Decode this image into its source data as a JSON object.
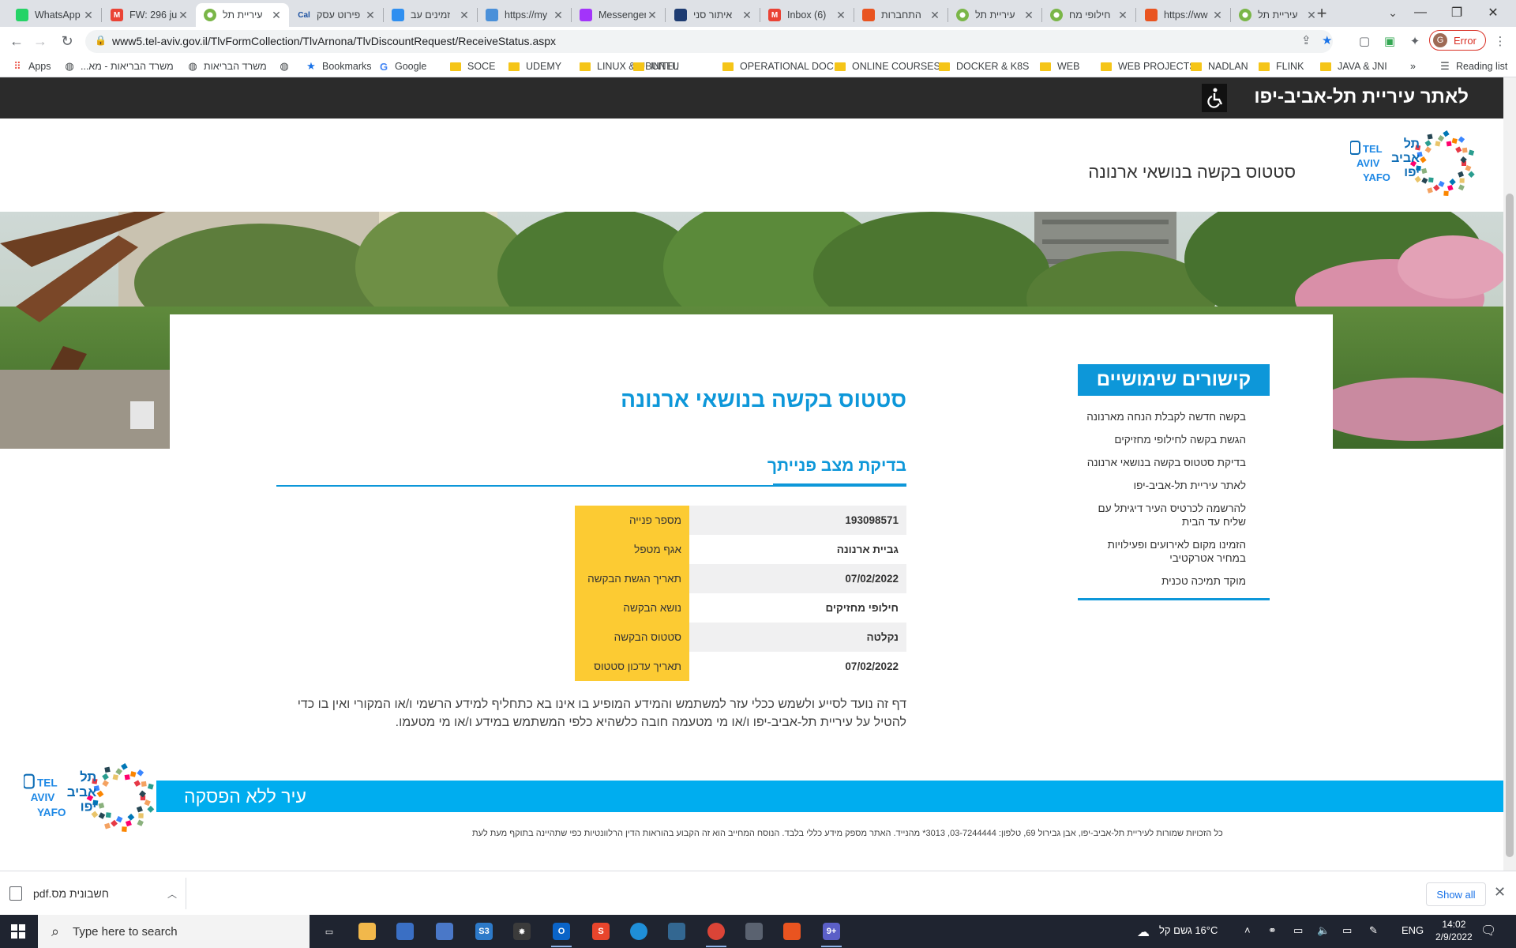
{
  "browser": {
    "tabs": [
      {
        "label": "WhatsApp",
        "icon": "whatsapp-icon",
        "color": "#25d366",
        "glyph": "",
        "active": false
      },
      {
        "label": "FW: 296 ju",
        "icon": "gmail-icon",
        "color": "#ea4335",
        "glyph": "M",
        "active": false
      },
      {
        "label": "עיריית תל",
        "icon": "tel-aviv-icon",
        "color": "#7ab648",
        "glyph": "",
        "active": true
      },
      {
        "label": "פירוט עסק",
        "icon": "cal-icon",
        "color": "#1a4fa0",
        "glyph": "Cal",
        "active": false
      },
      {
        "label": "זמינים עב",
        "icon": "edge-icon",
        "color": "#2f8ff0",
        "glyph": "",
        "active": false
      },
      {
        "label": "https://my",
        "icon": "web-icon",
        "color": "#4a90d9",
        "glyph": "",
        "active": false
      },
      {
        "label": "Messenger",
        "icon": "messenger-icon",
        "color": "#a334fa",
        "glyph": "",
        "active": false
      },
      {
        "label": "איתור סני",
        "icon": "drop-icon",
        "color": "#1e3c72",
        "glyph": "",
        "active": false
      },
      {
        "label": "Inbox (6)",
        "icon": "gmail-icon",
        "color": "#ea4335",
        "glyph": "M",
        "active": false
      },
      {
        "label": "התחברות",
        "icon": "ubuntu-icon",
        "color": "#e95420",
        "glyph": "",
        "active": false
      },
      {
        "label": "עיריית תל",
        "icon": "tel-aviv-icon",
        "color": "#7ab648",
        "glyph": "",
        "active": false
      },
      {
        "label": "חילופי מח",
        "icon": "tel-aviv-icon",
        "color": "#7ab648",
        "glyph": "",
        "active": false
      },
      {
        "label": "https://ww",
        "icon": "ubuntu-icon",
        "color": "#e95420",
        "glyph": "",
        "active": false
      },
      {
        "label": "עיריית תל",
        "icon": "tel-aviv-icon",
        "color": "#7ab648",
        "glyph": "",
        "active": false
      }
    ],
    "url": "www5.tel-aviv.gov.il/TlvFormCollection/TlvArnona/TlvDiscountRequest/ReceiveStatus.aspx",
    "profile_status": "Error",
    "profile_initial": "G",
    "bookmarks": [
      {
        "label": "Apps",
        "type": "apps"
      },
      {
        "label": "משרד הבריאות - מא...",
        "type": "site"
      },
      {
        "label": "משרד הבריאות",
        "type": "site"
      },
      {
        "label": "",
        "type": "site"
      },
      {
        "label": "Bookmarks",
        "type": "star"
      },
      {
        "label": "Google",
        "type": "google"
      },
      {
        "label": "SOCE",
        "type": "folder"
      },
      {
        "label": "UDEMY",
        "type": "folder"
      },
      {
        "label": "LINUX & UBUNTU",
        "type": "folder"
      },
      {
        "label": "INTEL",
        "type": "folder"
      },
      {
        "label": "OPERATIONAL DOC...",
        "type": "folder"
      },
      {
        "label": "ONLINE COURSES",
        "type": "folder"
      },
      {
        "label": "DOCKER & K8S",
        "type": "folder"
      },
      {
        "label": "WEB",
        "type": "folder"
      },
      {
        "label": "WEB PROJECTS",
        "type": "folder"
      },
      {
        "label": "NADLAN",
        "type": "folder"
      },
      {
        "label": "FLINK",
        "type": "folder"
      },
      {
        "label": "JAVA & JNI",
        "type": "folder"
      }
    ],
    "bookmarks_overflow": "»",
    "reading_list": "Reading list"
  },
  "page": {
    "topbar_link": "לאתר עיריית תל-אביב-יפו",
    "heading": "סטטוס בקשה בנושאי ארנונה",
    "logo": {
      "line1": "תל",
      "line2": "אביב",
      "line3": "יפו",
      "latin1": "TEL",
      "latin2": "AVIV",
      "latin3": "YAFO"
    },
    "sidebar": {
      "title": "קישורים שימושיים",
      "links": [
        "בקשה חדשה לקבלת הנחה מארנונה",
        "הגשת בקשה לחילופי מחזיקים",
        "בדיקת סטטוס בקשה בנושאי ארנונה",
        "לאתר עיריית תל-אביב-יפו",
        "להרשמה לכרטיס העיר דיגיתל עם שליח עד הבית",
        "הזמינו מקום לאירועים ופעילויות במחיר אטרקטיבי",
        "מוקד תמיכה טכנית"
      ]
    },
    "main_title": "סטטוס בקשה בנושאי ארנונה",
    "sub_title": "בדיקת מצב פנייתך",
    "status_rows": [
      {
        "label": "מספר פנייה",
        "value": "193098571"
      },
      {
        "label": "אגף מטפל",
        "value": "גביית ארנונה"
      },
      {
        "label": "תאריך הגשת הבקשה",
        "value": "07/02/2022"
      },
      {
        "label": "נושא הבקשה",
        "value": "חילופי מחזיקים"
      },
      {
        "label": "סטטוס הבקשה",
        "value": "נקלטה"
      },
      {
        "label": "תאריך עדכון סטטוס",
        "value": "07/02/2022"
      }
    ],
    "disclaimer": "דף זה נועד לסייע ולשמש ככלי עזר למשתמש והמידע המופיע בו אינו בא כתחליף למידע הרשמי ו/או המקורי ואין בו כדי להטיל על עיריית תל-אביב-יפו ו/או מי מטעמה חובה כלשהיא כלפי המשתמש במידע ו/או מי מטעמו.",
    "footer_slogan": "עיר ללא הפסקה",
    "footer_text": "כל הזכויות שמורות לעיריית תל-אביב-יפו, אבן גבירול 69, טלפון: 03-7244444, 3013* מהנייד. האתר מספק מידע כללי בלבד. הנוסח המחייב הוא זה הקבוע בהוראות הדין הרלוונטיות כפי שתהיינה בתוקף מעת לעת",
    "colors": {
      "primary": "#0d97d9",
      "table_label": "#fccb33",
      "footer_band": "#00adef",
      "topbar": "#2b2b2b"
    }
  },
  "downloads": {
    "file": "חשבונית מס.pdf",
    "show_all": "Show all"
  },
  "taskbar": {
    "search_placeholder": "Type here to search",
    "weather": "16°C  גשם קל",
    "language": "ENG",
    "time": "14:02",
    "date": "2/9/2022",
    "apps": [
      {
        "name": "task-view-icon",
        "color": "#1f2430",
        "glyph": "▭"
      },
      {
        "name": "file-explorer-icon",
        "color": "#f2b84b",
        "glyph": ""
      },
      {
        "name": "people-app-icon",
        "color": "#3a6fc4",
        "glyph": ""
      },
      {
        "name": "remote-app-icon",
        "color": "#4a78c8",
        "glyph": ""
      },
      {
        "name": "s3-browser-icon",
        "color": "#2d7ac9",
        "glyph": "S3"
      },
      {
        "name": "photo-app-icon",
        "color": "#3b3b3b",
        "glyph": "✸"
      },
      {
        "name": "outlook-icon",
        "color": "#0a64c8",
        "glyph": "O"
      },
      {
        "name": "s-app-icon",
        "color": "#e8452c",
        "glyph": "S"
      },
      {
        "name": "edge-icon",
        "color": "#1f8fd8",
        "glyph": ""
      },
      {
        "name": "postgres-icon",
        "color": "#336791",
        "glyph": ""
      },
      {
        "name": "chrome-icon",
        "color": "#db4437",
        "glyph": ""
      },
      {
        "name": "calculator-icon",
        "color": "#5a6270",
        "glyph": ""
      },
      {
        "name": "ubuntu-icon",
        "color": "#e95420",
        "glyph": ""
      },
      {
        "name": "teams-icon",
        "color": "#5b5fc7",
        "glyph": "9+"
      }
    ]
  }
}
